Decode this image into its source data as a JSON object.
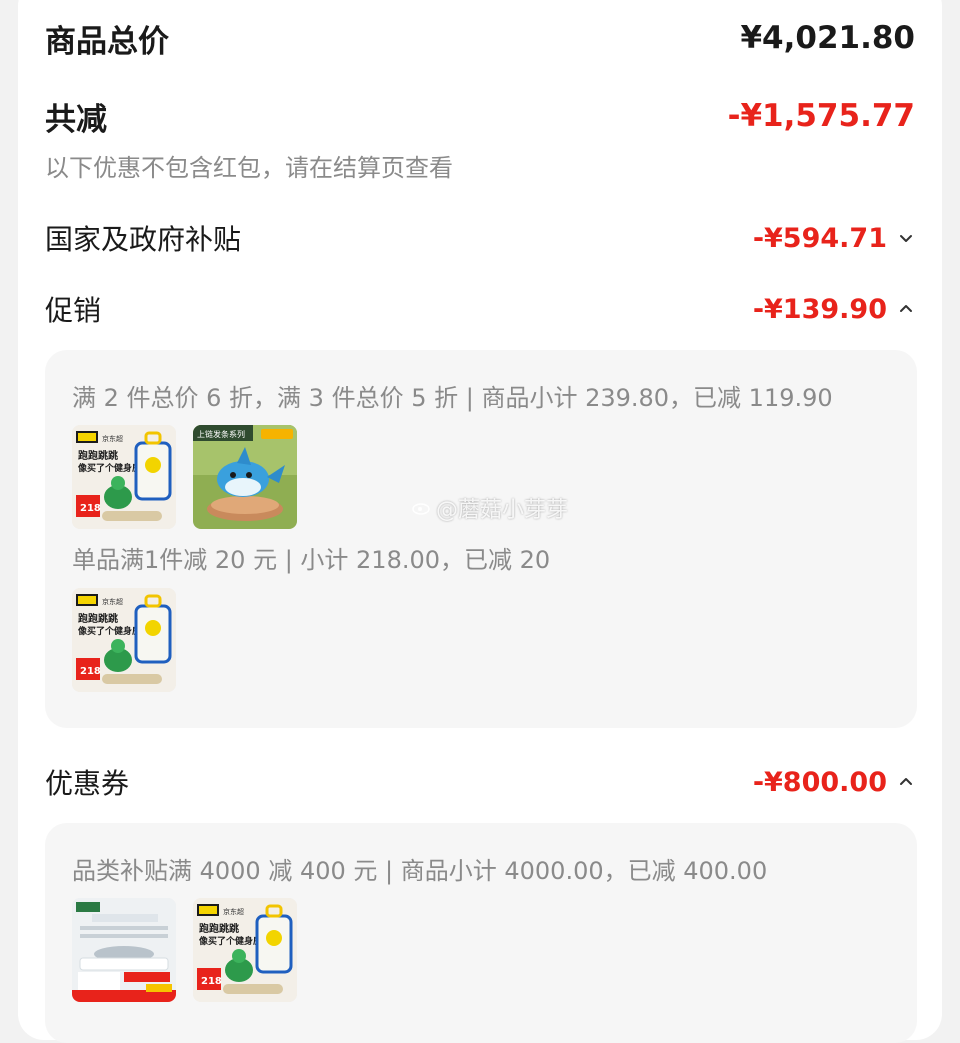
{
  "summary": {
    "total_label": "商品总价",
    "total_value": "¥4,021.80",
    "reduce_label": "共减",
    "reduce_value": "-¥1,575.77",
    "reduce_note": "以下优惠不包含红包，请在结算页查看"
  },
  "sections": {
    "gov": {
      "label": "国家及政府补贴",
      "value": "-¥594.71",
      "chevron": "chevron-down-icon"
    },
    "promo": {
      "label": "促销",
      "value": "-¥139.90",
      "chevron": "chevron-up-icon"
    },
    "coupon": {
      "label": "优惠券",
      "value": "-¥800.00",
      "chevron": "chevron-up-icon"
    }
  },
  "promo_panel": {
    "rules": [
      {
        "text": "满 2 件总价 6 折，满 3 件总价 5 折 | 商品小计 239.80，已减 119.90"
      },
      {
        "text": "单品满1件减 20 元 | 小计 218.00，已减 20"
      }
    ],
    "product_text": {
      "fitness_toy_line1": "跑跑跳跳",
      "fitness_toy_line2": "像买了个健身房",
      "fitness_toy_price": "218",
      "shark_banner": "上链发条系列"
    }
  },
  "coupon_panel": {
    "rule": "品类补贴满 4000 减 400 元 | 商品小计 4000.00，已减 400.00"
  },
  "watermark": "@蘑菇小芽芽",
  "colors": {
    "red": "#e8231b",
    "text": "#1a1a1a",
    "muted": "#8a8a8a",
    "panel": "#f6f6f6"
  }
}
